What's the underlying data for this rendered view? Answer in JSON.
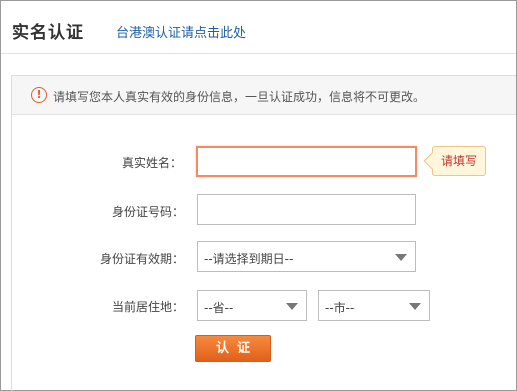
{
  "header": {
    "title": "实名认证",
    "hk_link": "台港澳认证请点击此处"
  },
  "notice": {
    "icon_text": "!",
    "text": "请填写您本人真实有效的身份信息，一旦认证成功，信息将不可更改。"
  },
  "form": {
    "name_label": "真实姓名：",
    "name_value": "",
    "name_tip": "请填写",
    "id_label": "身份证号码：",
    "id_value": "",
    "expiry_label": "身份证有效期：",
    "expiry_value": "--请选择到期日--",
    "residence_label": "当前居住地：",
    "province_value": "--省--",
    "city_value": "--市--",
    "submit_label": "认证"
  },
  "colors": {
    "accent": "#e8691f",
    "link": "#1f5fa8",
    "warning": "#e45d2c"
  }
}
